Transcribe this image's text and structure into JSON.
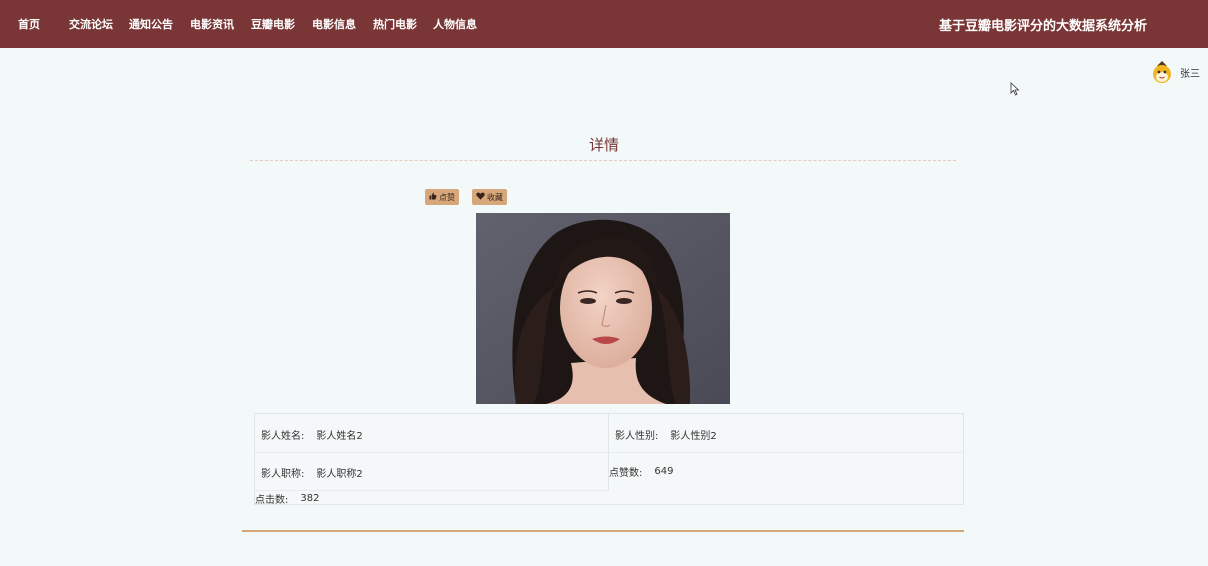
{
  "nav": {
    "items": [
      {
        "label": "首页"
      },
      {
        "label": "交流论坛"
      },
      {
        "label": "通知公告"
      },
      {
        "label": "电影资讯"
      },
      {
        "label": "豆瓣电影"
      },
      {
        "label": "电影信息"
      },
      {
        "label": "热门电影"
      },
      {
        "label": "人物信息"
      }
    ],
    "site_title": "基于豆瓣电影评分的大数据系统分析"
  },
  "user": {
    "name": "张三",
    "avatar_icon": "cartoon-avatar-icon"
  },
  "page": {
    "title": "详情"
  },
  "actions": {
    "like": {
      "label": "点赞",
      "icon": "thumbs-up-icon"
    },
    "favorite": {
      "label": "收藏",
      "icon": "heart-icon"
    }
  },
  "details": {
    "name": {
      "label": "影人姓名:",
      "value": "影人姓名2"
    },
    "gender": {
      "label": "影人性别:",
      "value": "影人性别2"
    },
    "title": {
      "label": "影人职称:",
      "value": "影人职称2"
    },
    "likes": {
      "label": "点赞数:",
      "value": "649"
    },
    "clicks": {
      "label": "点击数:",
      "value": "382"
    }
  },
  "colors": {
    "header_bg": "#7a3636",
    "accent": "#d6a77b",
    "page_bg": "#f3f8f8"
  }
}
